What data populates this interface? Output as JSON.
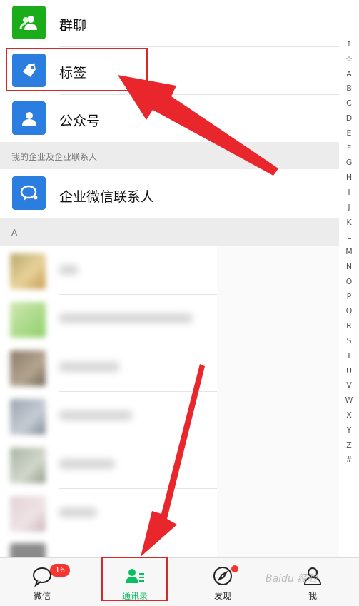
{
  "menu": [
    {
      "label": "群聊",
      "color": "#1aad19",
      "icon": "group-chat-icon"
    },
    {
      "label": "标签",
      "color": "#2b7ee0",
      "icon": "tag-icon"
    },
    {
      "label": "公众号",
      "color": "#2b7ee0",
      "icon": "official-account-icon"
    }
  ],
  "enterprise": {
    "section_label": "我的企业及企业联系人",
    "item_label": "企业微信联系人",
    "color": "#2b7ee0",
    "icon": "wecom-contact-icon"
  },
  "contacts_section": "A",
  "index_letters": [
    "↑",
    "☆",
    "A",
    "B",
    "C",
    "D",
    "E",
    "F",
    "G",
    "H",
    "I",
    "J",
    "K",
    "L",
    "M",
    "N",
    "O",
    "P",
    "Q",
    "R",
    "S",
    "T",
    "U",
    "V",
    "W",
    "X",
    "Y",
    "Z",
    "#"
  ],
  "tabs": [
    {
      "label": "微信",
      "icon": "chat-bubble-icon",
      "badge": "16",
      "active": false
    },
    {
      "label": "通讯录",
      "icon": "contacts-icon",
      "active": true
    },
    {
      "label": "发现",
      "icon": "compass-icon",
      "dot": true,
      "active": false
    },
    {
      "label": "我",
      "icon": "person-icon",
      "active": false
    }
  ],
  "watermark": "Baidu 经验",
  "colors": {
    "accent": "#07c160",
    "annotation_red": "#e8262b"
  }
}
